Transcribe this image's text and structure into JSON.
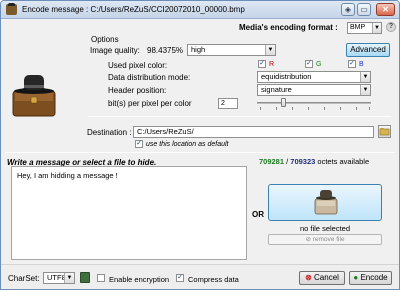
{
  "window": {
    "title": "Encode message : C:/Users/ReZuS/CCI20072010_00000.bmp",
    "buttons": [
      "◈",
      "▭",
      "✕"
    ]
  },
  "format": {
    "label": "Media's encoding format :",
    "value": "BMP",
    "help": "?"
  },
  "options": {
    "group_label": "Options",
    "image_quality_label": "Image quality:",
    "image_quality_percent": "98.4375%",
    "image_quality_value": "high",
    "advanced_button": "Advanced",
    "pixel_color_label": "Used pixel color:",
    "colors": [
      {
        "label": "R",
        "checked": "✓",
        "color": "#cc0000"
      },
      {
        "label": "G",
        "checked": "✓",
        "color": "#1c7a21"
      },
      {
        "label": "B",
        "checked": "✓",
        "color": "#1a2fcc"
      }
    ],
    "distribution_label": "Data distribution mode:",
    "distribution_value": "equidistribution",
    "header_label": "Header position:",
    "header_value": "signature",
    "bits_label": "bit(s) per pixel per color",
    "bits_value": "2"
  },
  "destination": {
    "label": "Destination :",
    "value": "C:/Users/ReZuS/",
    "default_checkbox": "✓",
    "default_label": "use this location as default"
  },
  "message": {
    "heading": "Write a message or select a file to hide.",
    "octets_used": "709281",
    "octets_total": "709323",
    "octets_suffix": "octets available",
    "text": "Hey, I am hidding a message !",
    "or_label": "OR",
    "no_file": "no file selected",
    "remove_button": "remove file"
  },
  "footer": {
    "charset_label": "CharSet:",
    "charset_value": "UTF8",
    "encryption_label": "Enable encryption",
    "encryption_checked": "",
    "compress_label": "Compress data",
    "compress_checked": "✓",
    "cancel_button": "Cancel",
    "encode_button": "Encode"
  }
}
